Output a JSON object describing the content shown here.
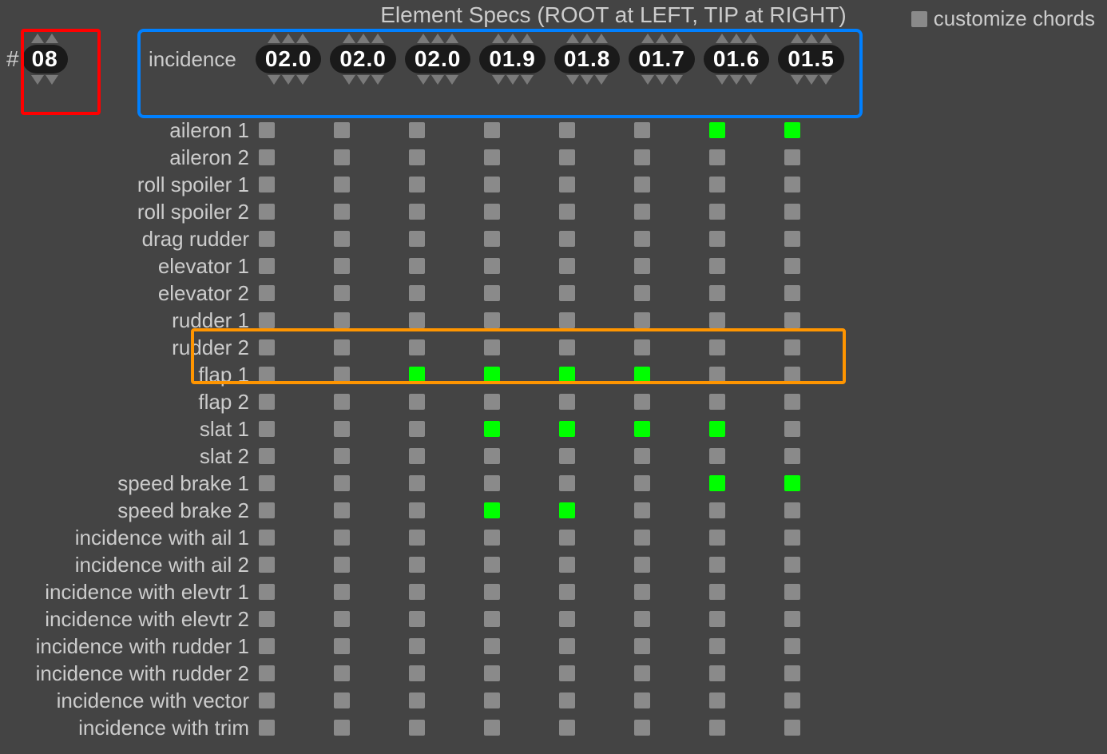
{
  "title": "Element Specs (ROOT at LEFT, TIP at RIGHT)",
  "customize_chords_label": "customize chords",
  "count_hash": "#",
  "count_value": "08",
  "incidence_label": "incidence",
  "incidence_values": [
    "02.0",
    "02.0",
    "02.0",
    "01.9",
    "01.8",
    "01.7",
    "01.6",
    "01.5"
  ],
  "colors": {
    "bg": "#444444",
    "text": "#cccccc",
    "pill_bg": "#1a1a1a",
    "cell_off": "#8a8a8a",
    "cell_on": "#00ff00",
    "red": "#ff0000",
    "blue": "#0080ff",
    "orange": "#ff9500"
  },
  "rows": [
    {
      "label": "aileron 1",
      "cells": [
        0,
        0,
        0,
        0,
        0,
        0,
        1,
        1
      ]
    },
    {
      "label": "aileron 2",
      "cells": [
        0,
        0,
        0,
        0,
        0,
        0,
        0,
        0
      ]
    },
    {
      "label": "roll spoiler 1",
      "cells": [
        0,
        0,
        0,
        0,
        0,
        0,
        0,
        0
      ]
    },
    {
      "label": "roll spoiler 2",
      "cells": [
        0,
        0,
        0,
        0,
        0,
        0,
        0,
        0
      ]
    },
    {
      "label": "drag rudder",
      "cells": [
        0,
        0,
        0,
        0,
        0,
        0,
        0,
        0
      ]
    },
    {
      "label": "elevator 1",
      "cells": [
        0,
        0,
        0,
        0,
        0,
        0,
        0,
        0
      ]
    },
    {
      "label": "elevator 2",
      "cells": [
        0,
        0,
        0,
        0,
        0,
        0,
        0,
        0
      ]
    },
    {
      "label": "rudder 1",
      "cells": [
        0,
        0,
        0,
        0,
        0,
        0,
        0,
        0
      ]
    },
    {
      "label": "rudder 2",
      "cells": [
        0,
        0,
        0,
        0,
        0,
        0,
        0,
        0
      ]
    },
    {
      "label": "flap 1",
      "cells": [
        0,
        0,
        1,
        1,
        1,
        1,
        0,
        0
      ]
    },
    {
      "label": "flap 2",
      "cells": [
        0,
        0,
        0,
        0,
        0,
        0,
        0,
        0
      ]
    },
    {
      "label": "slat 1",
      "cells": [
        0,
        0,
        0,
        1,
        1,
        1,
        1,
        0
      ]
    },
    {
      "label": "slat 2",
      "cells": [
        0,
        0,
        0,
        0,
        0,
        0,
        0,
        0
      ]
    },
    {
      "label": "speed brake 1",
      "cells": [
        0,
        0,
        0,
        0,
        0,
        0,
        1,
        1
      ]
    },
    {
      "label": "speed brake 2",
      "cells": [
        0,
        0,
        0,
        1,
        1,
        0,
        0,
        0
      ]
    },
    {
      "label": "incidence with ail 1",
      "cells": [
        0,
        0,
        0,
        0,
        0,
        0,
        0,
        0
      ]
    },
    {
      "label": "incidence with ail 2",
      "cells": [
        0,
        0,
        0,
        0,
        0,
        0,
        0,
        0
      ]
    },
    {
      "label": "incidence with elevtr 1",
      "cells": [
        0,
        0,
        0,
        0,
        0,
        0,
        0,
        0
      ]
    },
    {
      "label": "incidence with elevtr 2",
      "cells": [
        0,
        0,
        0,
        0,
        0,
        0,
        0,
        0
      ]
    },
    {
      "label": "incidence with rudder 1",
      "cells": [
        0,
        0,
        0,
        0,
        0,
        0,
        0,
        0
      ]
    },
    {
      "label": "incidence with rudder 2",
      "cells": [
        0,
        0,
        0,
        0,
        0,
        0,
        0,
        0
      ]
    },
    {
      "label": "incidence with vector",
      "cells": [
        0,
        0,
        0,
        0,
        0,
        0,
        0,
        0
      ]
    },
    {
      "label": "incidence with trim",
      "cells": [
        0,
        0,
        0,
        0,
        0,
        0,
        0,
        0
      ]
    }
  ]
}
